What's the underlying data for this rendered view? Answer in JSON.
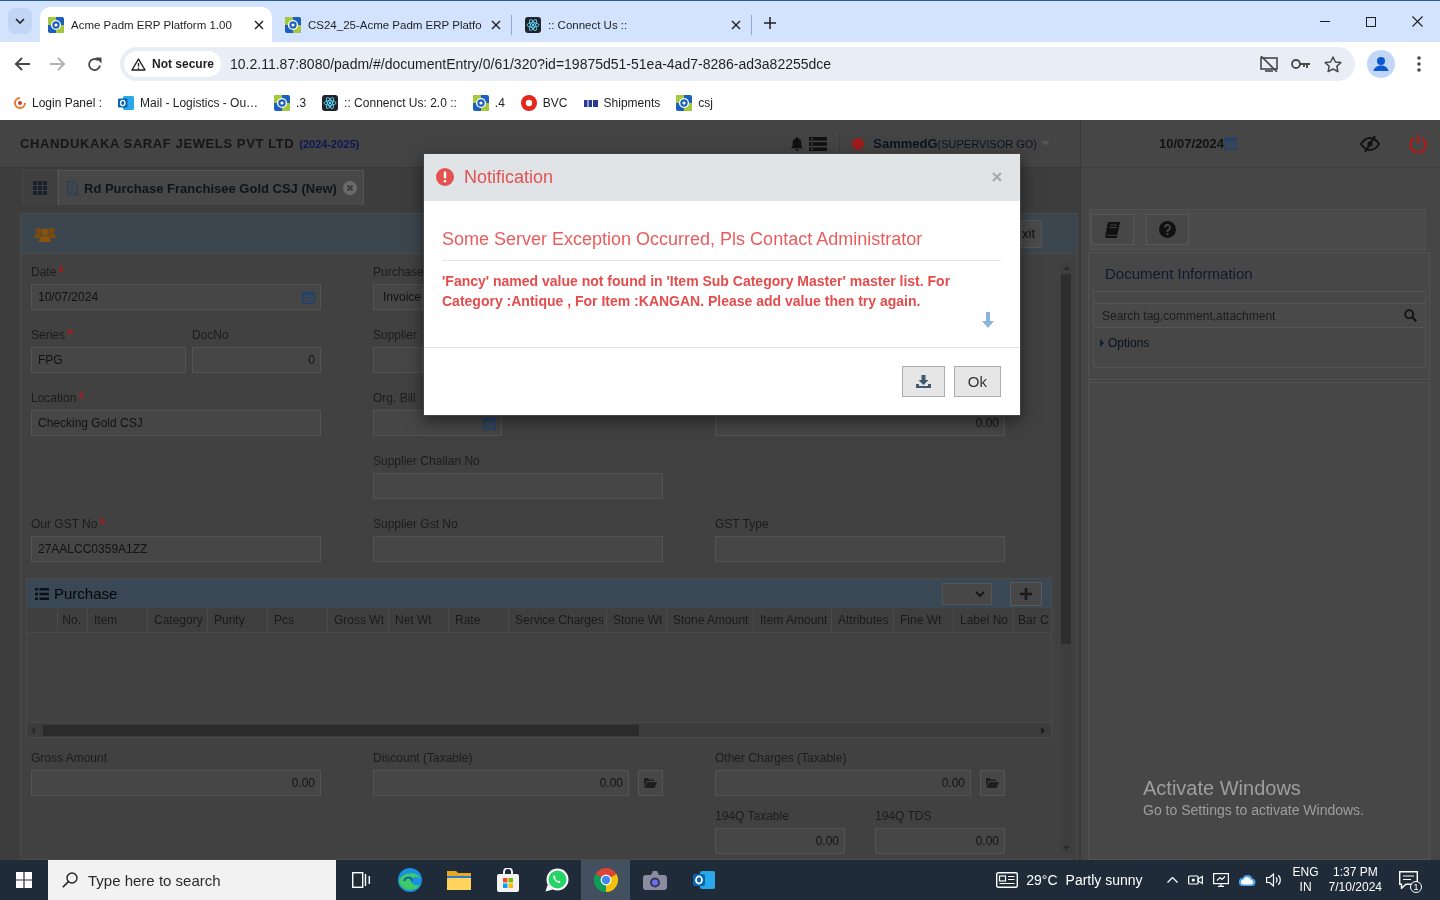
{
  "browser": {
    "tabs": [
      {
        "title": "Acme Padm ERP Platform 1.00",
        "kind": "app",
        "selected": true
      },
      {
        "title": "CS24_25-Acme Padm ERP Platfo",
        "kind": "app",
        "selected": false
      },
      {
        "title": ":: Connect Us ::",
        "kind": "atom",
        "selected": false
      }
    ],
    "security": "Not secure",
    "url": "10.2.11.87:8080/padm/#/documentEntry/0/61/320?id=19875d51-51ea-4ad7-8286-ad3a82255dce",
    "bookmarks": [
      {
        "label": "Login Panel :",
        "kind": "logo"
      },
      {
        "label": "Mail - Logistics - Ou…",
        "kind": "mail"
      },
      {
        "label": ".3",
        "kind": "app"
      },
      {
        "label": ":: Connenct Us: 2.0 ::",
        "kind": "atom"
      },
      {
        "label": ".4",
        "kind": "app"
      },
      {
        "label": "BVC",
        "kind": "record"
      },
      {
        "label": "Shipments",
        "kind": "badge"
      },
      {
        "label": "csj",
        "kind": "app"
      }
    ]
  },
  "app": {
    "company": "CHANDUKAKA SARAF JEWELS PVT LTD",
    "period": "(2024-2025)",
    "user": {
      "name": "SammedG",
      "role": "(SUPERVISOR GO)"
    },
    "document_tab": {
      "label": "Rd Purchase Franchisee Gold CSJ (New)",
      "selected": true
    },
    "exit_button": "xit",
    "form": {
      "rows": [
        {
          "left": [
            {
              "label": "Date",
              "required": true,
              "value": "10/07/2024",
              "kind": "date"
            }
          ],
          "middle": [
            {
              "label": "Purchase",
              "required": false,
              "value": "Invoice",
              "kind": "text"
            }
          ]
        },
        {
          "left": [
            {
              "label": "Series",
              "required": true,
              "value": "FPG",
              "kind": "text"
            },
            {
              "label": "DocNo",
              "required": false,
              "value": "0",
              "kind": "number"
            }
          ],
          "middle": [
            {
              "label": "Supplier",
              "required": false,
              "kind": "text"
            }
          ]
        },
        {
          "left": [
            {
              "label": "Location",
              "required": true,
              "value": "Checking Gold CSJ",
              "kind": "text"
            }
          ],
          "middle": [
            {
              "label": "Org. Bill",
              "required": false,
              "kind": "date"
            }
          ],
          "right": [
            {
              "required": false,
              "value": "0.00",
              "kind": "number"
            }
          ]
        },
        {
          "middle": [
            {
              "label": "Supplier Challan No",
              "required": false,
              "kind": "text"
            }
          ]
        },
        {
          "left": [
            {
              "label": "Our GST No",
              "required": true,
              "value": "27AALCC0359A1ZZ",
              "kind": "text"
            }
          ],
          "middle": [
            {
              "label": "Supplier Gst No",
              "required": false,
              "kind": "text"
            }
          ],
          "right": [
            {
              "label": "GST Type",
              "required": false,
              "kind": "text"
            }
          ]
        }
      ]
    },
    "purchase": {
      "title": "Purchase",
      "columns": [
        "No.",
        "Item",
        "Category",
        "Purity",
        "Pcs",
        "Gross Wt",
        "Net Wt",
        "Rate",
        "Service Charges",
        "Stone Wt",
        "Stone Amount",
        "Item Amount",
        "Attributes",
        "Fine Wt",
        "Label No",
        "Bar C"
      ]
    },
    "totals": {
      "rows": [
        {
          "left": [
            {
              "label": "Gross Amount",
              "required": false,
              "value": "0.00",
              "kind": "number"
            }
          ],
          "middle": [
            {
              "label": "Discount (Taxable)",
              "required": false,
              "value": "0.00",
              "kind": "number-action"
            }
          ],
          "right": [
            {
              "label": "Other Charges (Taxable)",
              "required": false,
              "value": "0.00",
              "kind": "number-action"
            }
          ]
        },
        {
          "right": [
            {
              "label": "194Q Taxable",
              "required": false,
              "value": "0.00",
              "kind": "number"
            },
            {
              "label": "194Q TDS",
              "required": false,
              "value": "0.00",
              "kind": "number"
            }
          ]
        }
      ]
    }
  },
  "sidebar": {
    "date": "10/07/2024",
    "panel_title": "Document Information",
    "search": {
      "placeholder": "Search tag,comment,attachment"
    },
    "options": {
      "label": "Options",
      "expanded": false
    }
  },
  "dialog": {
    "title": "Notification",
    "heading": "Some Server Exception Occurred, Pls Contact Administrator",
    "message": "'Fancy' named value not found in 'Item Sub Category Master' master list. For Category :Antique , For Item :KANGAN. Please add value then try again.",
    "ok_button": "Ok"
  },
  "activation_notice": {
    "title": "Activate Windows",
    "detail": "Go to Settings to activate Windows."
  },
  "taskbar": {
    "search": {
      "placeholder": "Type here to search"
    },
    "apps": [
      {
        "kind": "task-view",
        "selected": false
      },
      {
        "kind": "edge",
        "selected": false
      },
      {
        "kind": "files",
        "selected": false
      },
      {
        "kind": "store",
        "selected": false
      },
      {
        "kind": "whatsapp",
        "selected": false
      },
      {
        "kind": "chrome",
        "selected": true
      },
      {
        "kind": "camera",
        "selected": false
      },
      {
        "kind": "outlook",
        "selected": false
      }
    ],
    "weather": {
      "temperature": "29°C",
      "condition": "Partly sunny"
    },
    "language": {
      "code": "ENG",
      "region": "IN"
    },
    "clock": {
      "time": "1:37 PM",
      "date": "7/10/2024"
    },
    "notifications": "1"
  }
}
